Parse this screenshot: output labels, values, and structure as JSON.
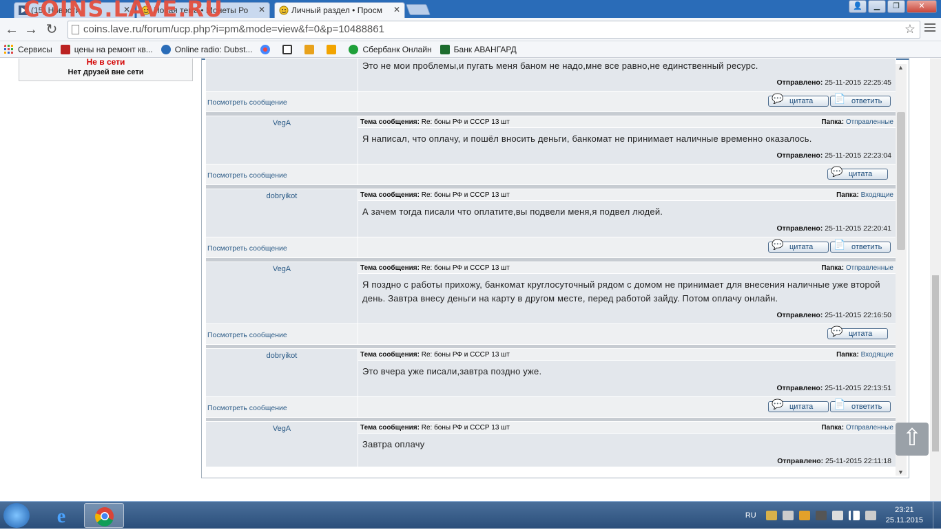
{
  "browser": {
    "tabs": [
      {
        "title": "(15) Новости",
        "active": false
      },
      {
        "title": "Новая тема • Монеты Ро",
        "active": false
      },
      {
        "title": "Личный раздел • Просм",
        "active": true
      }
    ],
    "watermark": "COINS.LAVE.RU",
    "url": "coins.lave.ru/forum/ucp.php?i=pm&mode=view&f=0&p=10488861",
    "bookmarks": [
      {
        "label": "Сервисы",
        "icon": "apps-grid-icon"
      },
      {
        "label": "цены на ремонт кв...",
        "icon": "page-icon"
      },
      {
        "label": "Online radio: Dubst...",
        "icon": "radio-icon"
      },
      {
        "label": "",
        "icon": "dots-icon"
      },
      {
        "label": "",
        "icon": "mail-icon"
      },
      {
        "label": "",
        "icon": "tv-icon"
      },
      {
        "label": "",
        "icon": "ctc-icon"
      },
      {
        "label": "Сбербанк Онлайн",
        "icon": "sberbank-icon"
      },
      {
        "label": "Банк АВАНГАРД",
        "icon": "avangard-icon"
      }
    ]
  },
  "sidebar": {
    "status": "Не в сети",
    "friends_note": "Нет друзей вне сети"
  },
  "labels": {
    "subject": "Тема сообщения:",
    "folder": "Папка:",
    "sent": "Отправлено:",
    "view_message": "Посмотреть сообщение",
    "quote": "цитата",
    "reply": "ответить"
  },
  "messages": [
    {
      "author": "",
      "subject": "",
      "folder": "",
      "text": "Это не мои проблемы,и пугать меня баном не надо,мне все равно,не единственный ресурс.",
      "sent": "25-11-2015 22:25:45",
      "has_reply": true,
      "partial_top": true
    },
    {
      "author": "VegA",
      "subject": "Re: боны РФ и СССР 13 шт",
      "folder": "Отправленные",
      "text": "Я написал, что оплачу, и пошёл вносить деньги, банкомат не принимает наличные временно оказалось.",
      "sent": "25-11-2015 22:23:04",
      "has_reply": false
    },
    {
      "author": "dobryikot",
      "subject": "Re: боны РФ и СССР 13 шт",
      "folder": "Входящие",
      "text": "А зачем тогда писали что оплатите,вы подвели меня,я подвел людей.",
      "sent": "25-11-2015 22:20:41",
      "has_reply": true
    },
    {
      "author": "VegA",
      "subject": "Re: боны РФ и СССР 13 шт",
      "folder": "Отправленные",
      "text": "Я поздно с работы прихожу, банкомат круглосуточный рядом с домом не принимает для внесения наличные уже второй день. Завтра внесу деньги на карту в другом месте, перед работой зайду. Потом оплачу онлайн.",
      "sent": "25-11-2015 22:16:50",
      "has_reply": false
    },
    {
      "author": "dobryikot",
      "subject": "Re: боны РФ и СССР 13 шт",
      "folder": "Входящие",
      "text": "Это вчера уже писали,завтра поздно уже.",
      "sent": "25-11-2015 22:13:51",
      "has_reply": true
    },
    {
      "author": "VegA",
      "subject": "Re: боны РФ и СССР 13 шт",
      "folder": "Отправленные",
      "text": "Завтра оплачу",
      "sent": "25-11-2015 22:11:18",
      "has_reply": false,
      "partial_bottom": true
    }
  ],
  "taskbar": {
    "lang": "RU",
    "time": "23:21",
    "date": "25.11.2015"
  },
  "colors": {
    "tabstrip": "#2a6cb8",
    "offline_red": "#d30000",
    "link_blue": "#2a5a86",
    "row_bg": "#e3e7ec"
  }
}
